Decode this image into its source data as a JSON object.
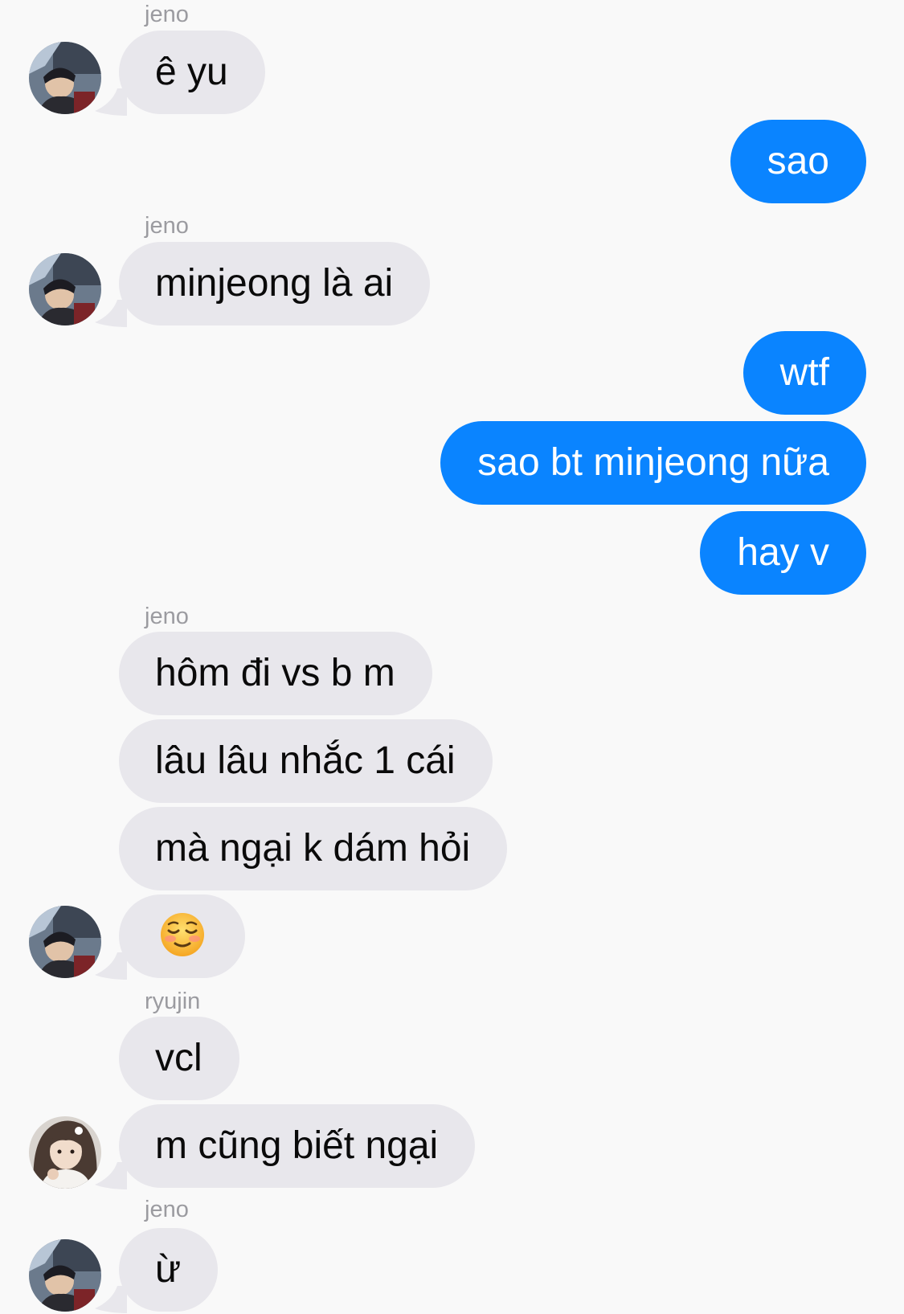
{
  "colors": {
    "background": "#f9f9f9",
    "incoming_bubble": "#e8e7ec",
    "outgoing_bubble": "#0a84ff",
    "sender_name": "#9b9ba0"
  },
  "messages": {
    "m1_sender": "jeno",
    "m1_text": "ê yu",
    "m2_text": "sao",
    "m3_sender": "jeno",
    "m3_text": "minjeong là ai",
    "m4_text": "wtf",
    "m5_text": "sao bt minjeong nữa",
    "m6_text": "hay v",
    "m7_sender": "jeno",
    "m7_text": "hôm đi vs b m",
    "m8_text": "lâu lâu nhắc 1 cái",
    "m9_text": "mà ngại k dám hỏi",
    "m10_emoji": "smiling-face-emoji",
    "m11_sender": "ryujin",
    "m11_text": "vcl",
    "m12_text": "m cũng biết ngại",
    "m13_sender": "jeno",
    "m13_text": "ừ"
  }
}
